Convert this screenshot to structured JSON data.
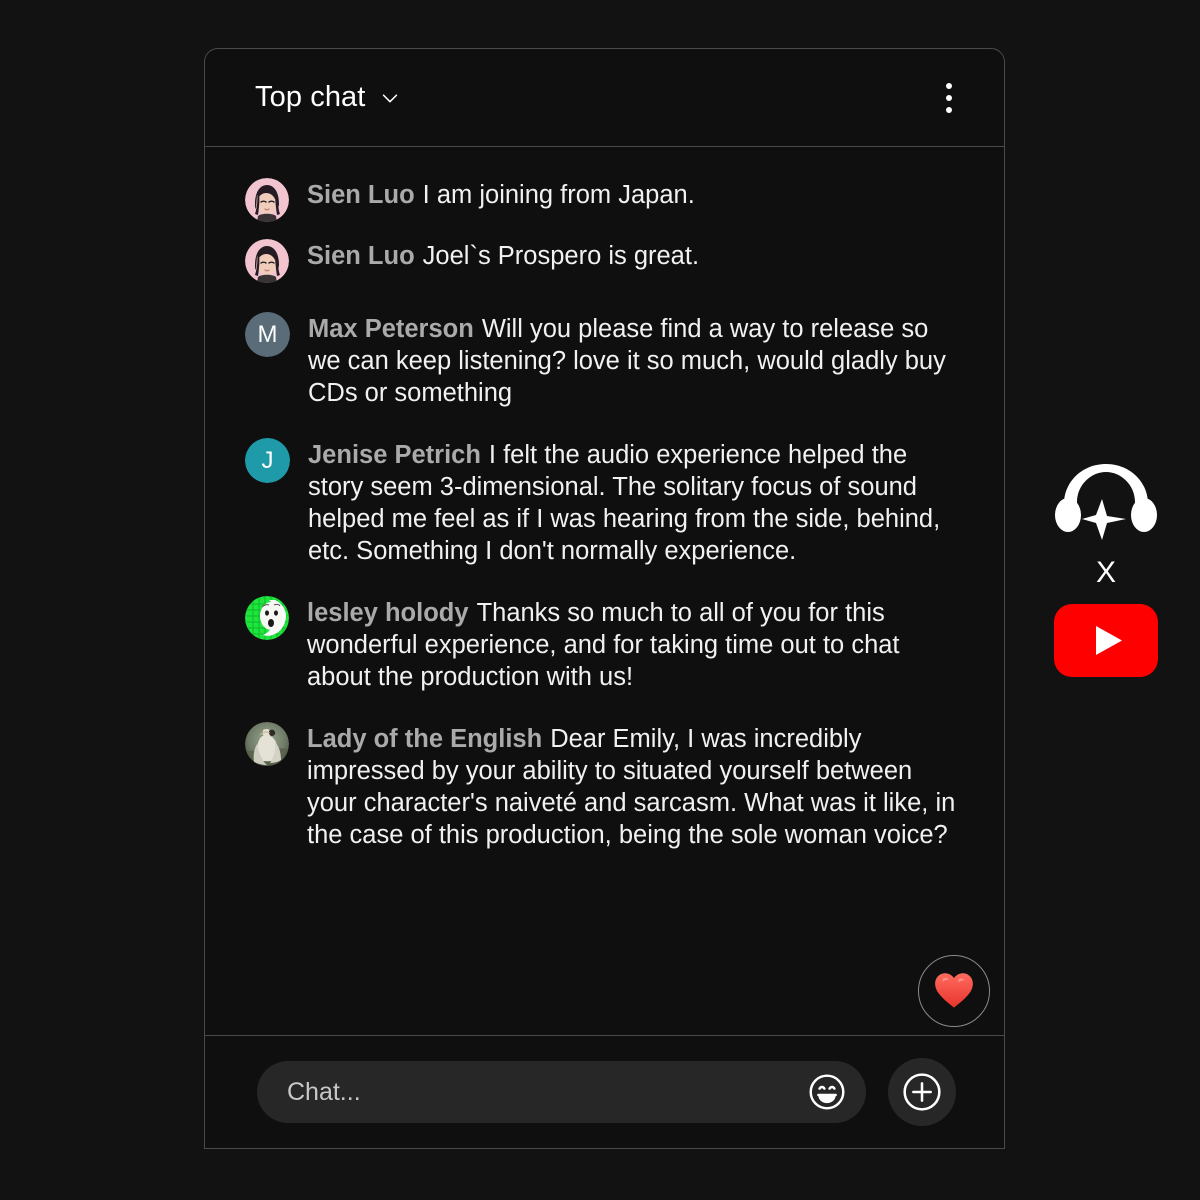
{
  "panel": {
    "header": {
      "title": "Top chat",
      "chevron_icon": "chevron-down-icon",
      "overflow_icon": "more-vertical-icon"
    },
    "messages": [
      {
        "author": "Sien Luo",
        "text": "I am joining from Japan.",
        "avatar_type": "image",
        "avatar_kind": "anime-girl-pink",
        "gap_before": false
      },
      {
        "author": "Sien Luo",
        "text": "Joel`s Prospero is great.",
        "avatar_type": "image",
        "avatar_kind": "anime-girl-pink",
        "gap_before": false
      },
      {
        "author": "Max Peterson",
        "text": "Will you please find a way to release so we can keep listening? love it so much, would gladly buy CDs or something",
        "avatar_type": "initial",
        "avatar_initial": "M",
        "avatar_color": "#5a6c77",
        "gap_before": true
      },
      {
        "author": "Jenise Petrich",
        "text": "I felt the audio experience helped the story seem 3-dimensional. The solitary focus of sound helped me feel as if I was hearing from the side, behind, etc. Something I don't normally experience.",
        "avatar_type": "initial",
        "avatar_initial": "J",
        "avatar_color": "#1f9aa8",
        "gap_before": true
      },
      {
        "author": "lesley holody",
        "text": "Thanks so much to all of you for this wonderful experience, and for taking time out to chat about the production with us!",
        "avatar_type": "image",
        "avatar_kind": "green-cartoon-face",
        "gap_before": true
      },
      {
        "author": "Lady of the English",
        "text": "Dear Emily, I was incredibly impressed by your ability to situated yourself between your character's naiveté and sarcasm. What was it like, in the case of this production, being the sole woman voice?",
        "avatar_type": "image",
        "avatar_kind": "painting-woman",
        "gap_before": true
      }
    ],
    "heart_button": {
      "icon": "heart-icon",
      "color": "#f04a43"
    },
    "composer": {
      "placeholder": "Chat...",
      "value": "",
      "emoji_icon": "smiley-face-icon",
      "add_icon": "plus-circle-icon"
    }
  },
  "branding": {
    "headphones_icon": "headphones-logo-icon",
    "separator": "X",
    "youtube_icon": "youtube-play-logo-icon",
    "youtube_color": "#ff0000"
  }
}
